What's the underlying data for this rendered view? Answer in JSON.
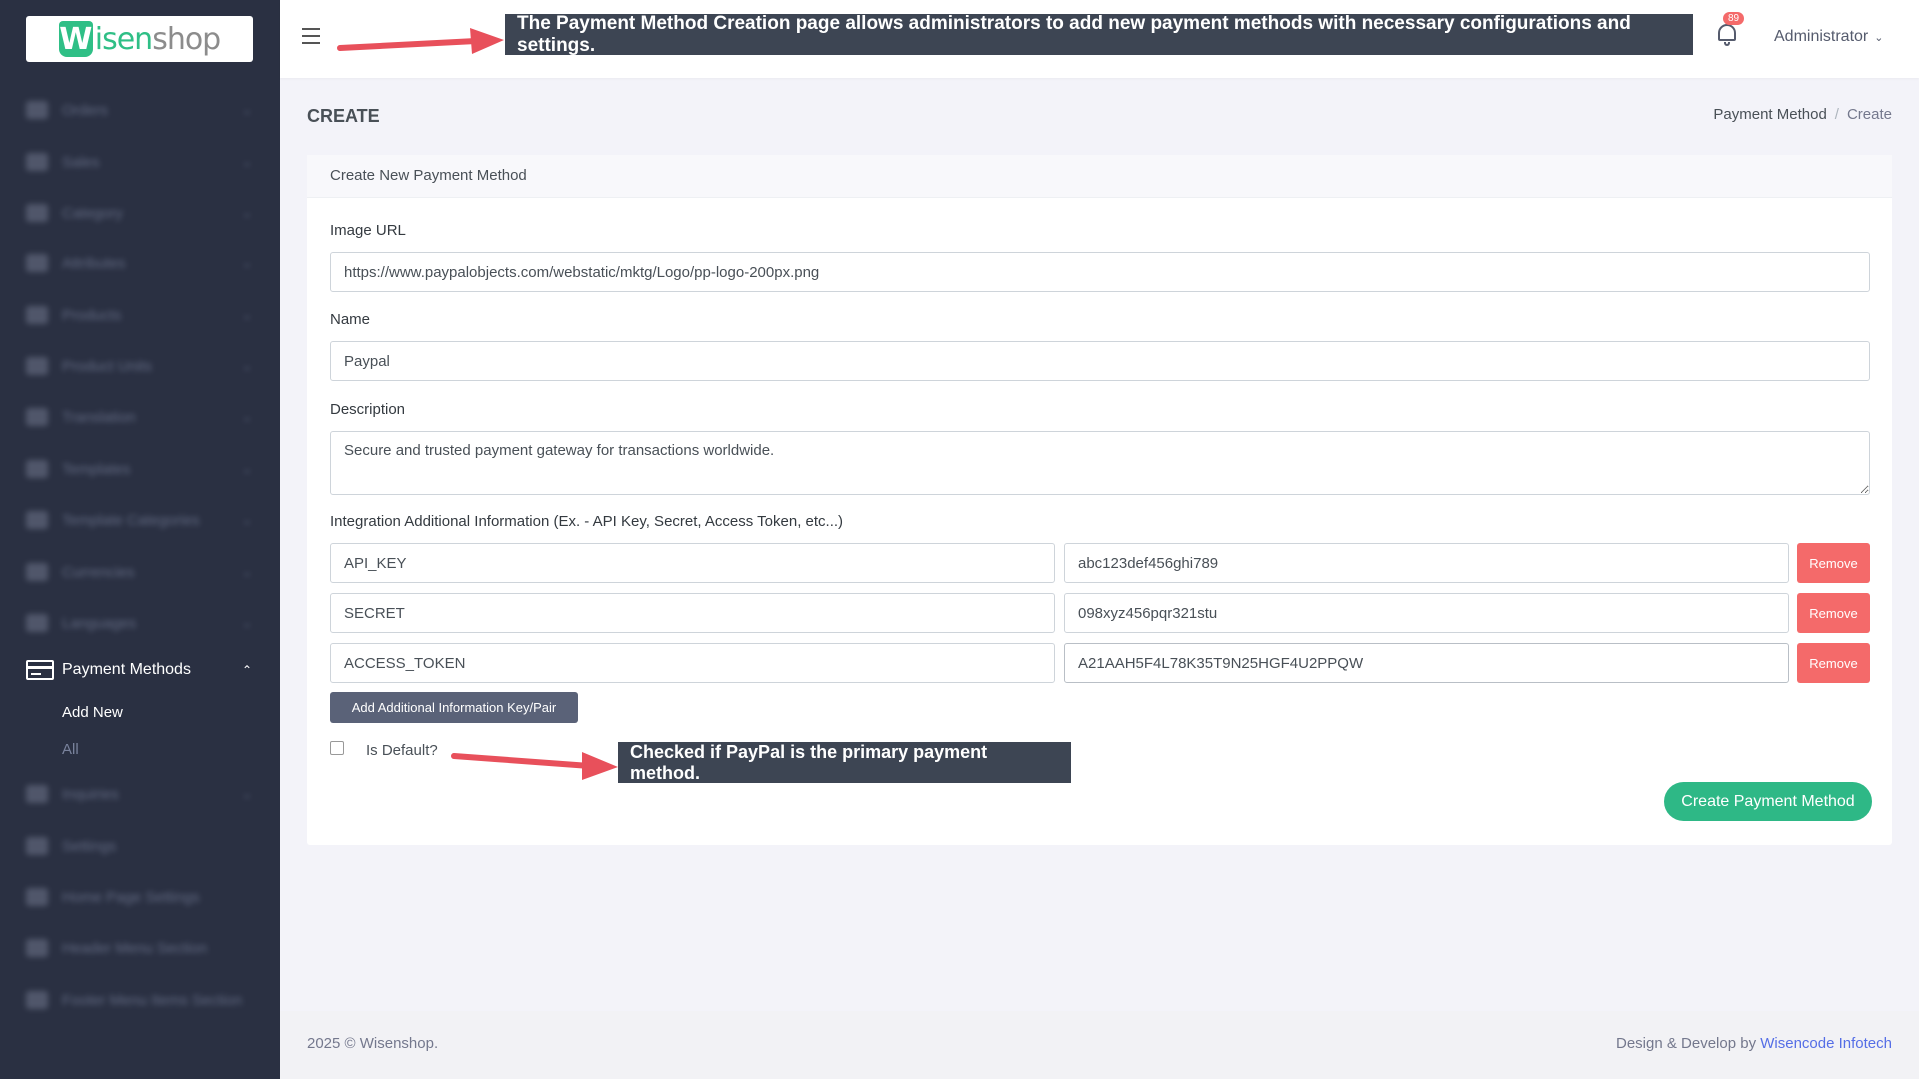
{
  "brand": {
    "logo_letter": "W",
    "logo_accent": "isen",
    "logo_rest": "shop"
  },
  "sidebar": {
    "blurred_items": [
      "Orders",
      "Sales",
      "Category",
      "Attributes",
      "Products",
      "Product Units",
      "Translation",
      "Templates",
      "Template Categories",
      "Currencies",
      "Languages"
    ],
    "lower_blurred_items": [
      "Inquiries",
      "Settings",
      "Home Page Settings",
      "Header Menu Section",
      "Footer Menu Items Section"
    ],
    "active_item": "Payment Methods",
    "sub_items": [
      "Add New",
      "All"
    ]
  },
  "topbar": {
    "notification_count": "89",
    "user_label": "Administrator"
  },
  "annotations": {
    "top": "The Payment Method Creation page allows administrators to add new payment methods with necessary configurations and settings.",
    "bottom": "Checked if PayPal is the primary payment method."
  },
  "page": {
    "title": "Create",
    "breadcrumb": [
      "Payment Method",
      "Create"
    ]
  },
  "form": {
    "card_title": "Create New Payment Method",
    "image_url_label": "Image URL",
    "image_url_value": "https://www.paypalobjects.com/webstatic/mktg/Logo/pp-logo-200px.png",
    "name_label": "Name",
    "name_value": "Paypal",
    "description_label": "Description",
    "description_value": "Secure and trusted payment gateway for transactions worldwide.",
    "integration_label": "Integration Additional Information (Ex. - API Key, Secret, Access Token, etc...)",
    "pairs": [
      {
        "key": "API_KEY",
        "value": "abc123def456ghi789"
      },
      {
        "key": "SECRET",
        "value": "098xyz456pqr321stu"
      },
      {
        "key": "ACCESS_TOKEN",
        "value": "A21AAH5F4L78K35T9N25HGF4U2PPQW"
      }
    ],
    "remove_label": "Remove",
    "add_pair_label": "Add Additional Information Key/Pair",
    "is_default_label": "Is Default?",
    "submit_label": "Create Payment Method"
  },
  "footer": {
    "copyright": "2025 © Wisenshop.",
    "credit_prefix": "Design & Develop by",
    "credit_link": "Wisencode Infotech"
  },
  "colors": {
    "sidebar": "#2a3042",
    "accent_green": "#2eb886",
    "danger": "#f46a6a",
    "annotation": "#3d4553",
    "arrow": "#e8505b"
  }
}
